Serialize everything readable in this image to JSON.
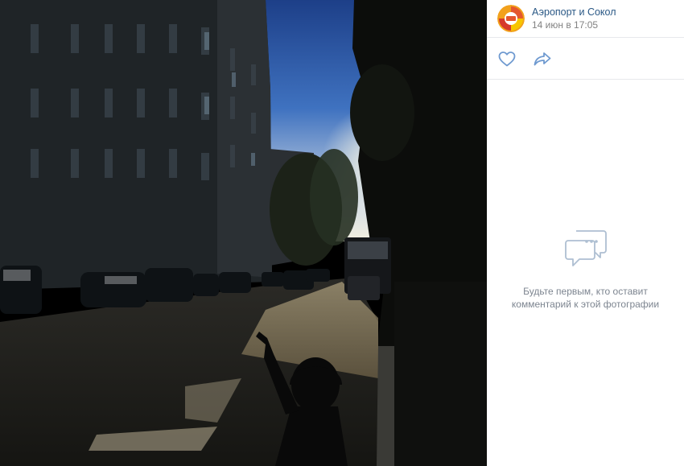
{
  "post": {
    "author": "Аэропорт и Сокол",
    "date": "14 июн в 17:05"
  },
  "actions": {
    "like_icon": "heart-icon",
    "share_icon": "share-arrow-icon"
  },
  "comments": {
    "empty_icon": "comment-bubbles-icon",
    "empty_line1": "Будьте первым, кто оставит",
    "empty_line2": "комментарий к этой фотографии"
  },
  "colors": {
    "link": "#2a5885",
    "muted": "#828282",
    "icon": "#6f9ad0",
    "divider": "#e7e8ec"
  }
}
